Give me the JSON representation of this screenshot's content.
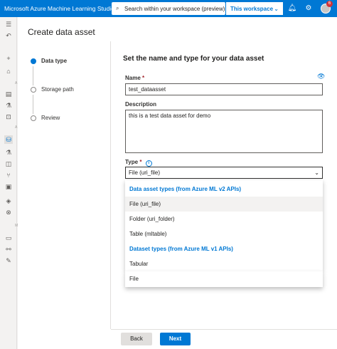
{
  "app": {
    "title": "Microsoft Azure Machine Learning Studio"
  },
  "search": {
    "placeholder": "Search within your workspace (preview)"
  },
  "workspace": {
    "label": "This workspace"
  },
  "notifications": {
    "count": "6"
  },
  "panel": {
    "title": "Create data asset"
  },
  "steps": [
    {
      "label": "Data type",
      "active": true
    },
    {
      "label": "Storage path",
      "active": false
    },
    {
      "label": "Review",
      "active": false
    }
  ],
  "form": {
    "heading": "Set the name and type for your data asset",
    "name": {
      "label": "Name",
      "required": "*",
      "value": "test_dataasset"
    },
    "description": {
      "label": "Description",
      "value": "this is a test data asset for demo"
    },
    "type": {
      "label": "Type",
      "required": "*",
      "value": "File (uri_file)"
    }
  },
  "dropdown": {
    "groups": [
      {
        "header": "Data asset types (from Azure ML v2 APIs)",
        "options": [
          "File (uri_file)",
          "Folder (uri_folder)",
          "Table (mltable)"
        ]
      },
      {
        "header": "Dataset types (from Azure ML v1 APIs)",
        "options": [
          "Tabular",
          "File"
        ]
      }
    ],
    "highlighted": "File (uri_file)"
  },
  "footer": {
    "back": "Back",
    "next": "Next"
  }
}
